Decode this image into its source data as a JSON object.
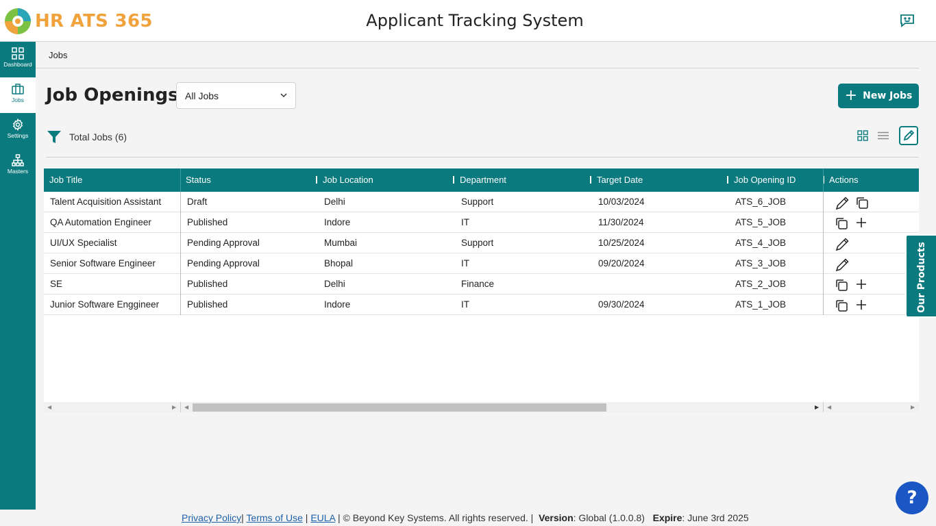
{
  "header": {
    "logo_text": "HR ATS 365",
    "title": "Applicant Tracking System"
  },
  "sidebar": {
    "items": [
      {
        "label": "Dashboard",
        "icon": "dashboard-icon"
      },
      {
        "label": "Jobs",
        "icon": "briefcase-icon",
        "active": true
      },
      {
        "label": "Settings",
        "icon": "gear-icon"
      },
      {
        "label": "Masters",
        "icon": "hierarchy-icon"
      }
    ]
  },
  "breadcrumb": "Jobs",
  "page_title": "Job Openings",
  "job_filter": {
    "selected": "All Jobs"
  },
  "new_jobs_label": "New Jobs",
  "total_jobs": "Total Jobs (6)",
  "table": {
    "columns": [
      "Job Title",
      "Status",
      "Job Location",
      "Department",
      "Target Date",
      "Job Opening ID",
      "Actions"
    ],
    "rows": [
      {
        "title": "Talent Acquisition Assistant",
        "status": "Draft",
        "location": "Delhi",
        "department": "Support",
        "target_date": "10/03/2024",
        "id": "ATS_6_JOB",
        "actions": [
          "edit",
          "copy"
        ]
      },
      {
        "title": "QA Automation Engineer",
        "status": "Published",
        "location": "Indore",
        "department": "IT",
        "target_date": "11/30/2024",
        "id": "ATS_5_JOB",
        "actions": [
          "copy",
          "add"
        ]
      },
      {
        "title": "UI/UX Specialist",
        "status": "Pending Approval",
        "location": "Mumbai",
        "department": "Support",
        "target_date": "10/25/2024",
        "id": "ATS_4_JOB",
        "actions": [
          "edit"
        ]
      },
      {
        "title": "Senior Software Engineer",
        "status": "Pending Approval",
        "location": "Bhopal",
        "department": "IT",
        "target_date": "09/20/2024",
        "id": "ATS_3_JOB",
        "actions": [
          "edit"
        ]
      },
      {
        "title": "SE",
        "status": "Published",
        "location": "Delhi",
        "department": "Finance",
        "target_date": "",
        "id": "ATS_2_JOB",
        "actions": [
          "copy",
          "add"
        ]
      },
      {
        "title": "Junior Software Enggineer",
        "status": "Published",
        "location": "Indore",
        "department": "IT",
        "target_date": "09/30/2024",
        "id": "ATS_1_JOB",
        "actions": [
          "copy",
          "add"
        ]
      }
    ]
  },
  "our_products_label": "Our Products",
  "footer": {
    "privacy": "Privacy Policy",
    "terms": "Terms of Use",
    "eula": "EULA",
    "copyright": "| © Beyond Key Systems. All rights reserved. |",
    "version_label": "Version",
    "version_value": ": Global (1.0.0.8)",
    "expire_label": "Expire",
    "expire_value": ": June 3rd 2025"
  },
  "help_label": "?",
  "colors": {
    "primary": "#0a7a7f",
    "brand_orange": "#f0a23c",
    "help_blue": "#1a56c4"
  }
}
